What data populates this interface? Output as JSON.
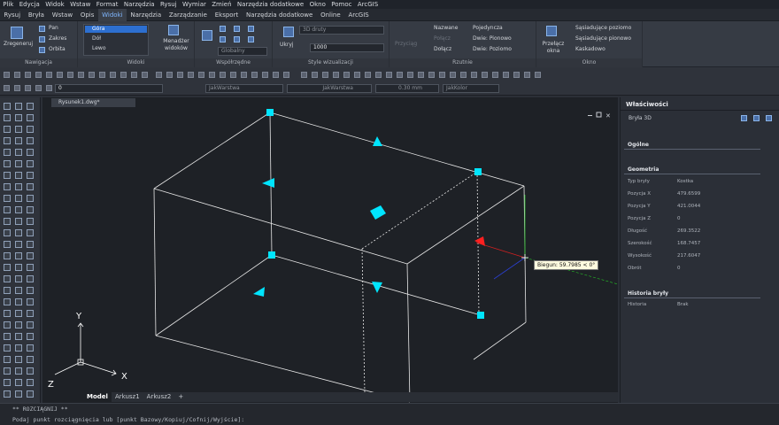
{
  "menu": [
    "Plik",
    "Edycja",
    "Widok",
    "Wstaw",
    "Format",
    "Narzędzia",
    "Rysuj",
    "Wymiar",
    "Zmień",
    "Narzędzia dodatkowe",
    "Okno",
    "Pomoc",
    "ArcGIS"
  ],
  "tabs": [
    "Rysuj",
    "Bryła",
    "Wstaw",
    "Opis",
    "Widoki",
    "Narzędzia",
    "Zarządzanie",
    "Eksport",
    "Narzędzia dodatkowe",
    "Online",
    "ArcGIS"
  ],
  "active_tab": "Widoki",
  "ribbon": {
    "nav": {
      "label": "Nawigacja",
      "zoom": "Zregeneruj",
      "pan": "Pan",
      "zoom2": "Zakres",
      "orbit": "Orbita"
    },
    "views": {
      "label": "Widoki",
      "list": [
        "Góra",
        "Dół",
        "Lewo"
      ],
      "manager": "Menadżer widoków"
    },
    "coords": {
      "label": "Współrzędne",
      "ucs_value": "Globalny"
    },
    "visual": {
      "label": "Style wizualizacji",
      "hide": "Ukryj",
      "style_value": "3D druty",
      "number_value": "1000"
    },
    "proj": {
      "label": "Rzutnie",
      "items": [
        "Przyciąg",
        "Nazwane",
        "Połącz",
        "Dołącz",
        "Pojedyncza",
        "Dwie: Pionowo",
        "Dwie: Poziomo"
      ]
    },
    "window": {
      "label": "Okno",
      "switch": "Przełącz okna",
      "items": [
        "Sąsiadujące poziomo",
        "Sąsiadujące pionowo",
        "Kaskadowo"
      ]
    }
  },
  "toolbar": {
    "layer": "0",
    "color": "JakWarstwa",
    "linetype": "JakWarstwa",
    "lineweight": "0.30 mm",
    "plotstyle": "JakKolor"
  },
  "drawing": {
    "doc_tab": "Rysunek1.dwg*",
    "tooltip": "Biegun: 59.7985 < 0°",
    "axis_x": "X",
    "axis_y": "Y",
    "axis_z": "Z",
    "layout_tabs": [
      "Model",
      "Arkusz1",
      "Arkusz2"
    ],
    "add_tab": "+"
  },
  "command": {
    "line1": "** ROZCIĄGNIJ **",
    "line2": "Podaj punkt rozciągnięcia lub [punkt Bazowy/Kopiuj/Cofnij/Wyjście]:"
  },
  "properties": {
    "title": "Właściwości",
    "object": "Bryła 3D",
    "sections": {
      "general": "Ogólne",
      "geometry": "Geometria",
      "history": "Historia bryły"
    },
    "geometry_rows": [
      {
        "k": "Typ bryły",
        "v": "Kostka"
      },
      {
        "k": "Pozycja X",
        "v": "479.6599"
      },
      {
        "k": "Pozycja Y",
        "v": "421.0044"
      },
      {
        "k": "Pozycja Z",
        "v": "0"
      },
      {
        "k": "Długość",
        "v": "269.3522"
      },
      {
        "k": "Szerokość",
        "v": "168.7457"
      },
      {
        "k": "Wysokość",
        "v": "217.6047"
      },
      {
        "k": "Obrót",
        "v": "0"
      }
    ],
    "history_rows": [
      {
        "k": "Historia",
        "v": "Brak"
      }
    ]
  },
  "colors": {
    "accent": "#00c8ff",
    "grip": "#00e5ff",
    "selected_grip": "#ff2020",
    "background": "#1e2126"
  }
}
